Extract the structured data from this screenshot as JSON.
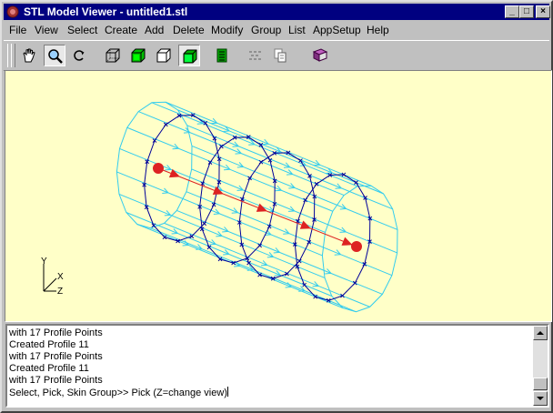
{
  "window": {
    "title": "STL Model Viewer - untitled1.stl",
    "controls": {
      "minimize": "_",
      "maximize": "□",
      "close": "×"
    }
  },
  "menu": [
    "File",
    "View",
    "Select",
    "Create",
    "Add",
    "Delete",
    "Modify",
    "Group",
    "List",
    "AppSetup",
    "Help"
  ],
  "toolbar": {
    "tools": [
      {
        "icon": "hand-pan-icon",
        "pressed": false
      },
      {
        "icon": "zoom-magnifier-icon",
        "pressed": true
      },
      {
        "icon": "rotate-icon",
        "pressed": false
      },
      {
        "icon": "wireframe-cube-icon",
        "pressed": false
      },
      {
        "icon": "green-cube-icon",
        "pressed": false
      },
      {
        "icon": "hidden-line-cube-icon",
        "pressed": false
      },
      {
        "icon": "shaded-cube-icon",
        "pressed": true
      },
      {
        "icon": "spreadsheet-icon",
        "pressed": false
      },
      {
        "icon": "disabled-tool-icon",
        "pressed": false
      },
      {
        "icon": "copy-pages-icon",
        "pressed": false
      },
      {
        "icon": "book-icon",
        "pressed": false
      }
    ]
  },
  "axes": {
    "y": "Y",
    "x": "X",
    "z": "Z"
  },
  "colors": {
    "viewport_bg": "#ffffc8",
    "wire": "#33ccee",
    "profile": "#000099",
    "axis_line": "#dd2222"
  },
  "console": {
    "lines": [
      "with 17 Profile Points",
      "Created Profile 11",
      "with 17 Profile Points",
      "Created Profile 11",
      "with 17 Profile Points"
    ],
    "prompt": "Select, Pick, Skin Group>> Pick (Z=change view)"
  }
}
